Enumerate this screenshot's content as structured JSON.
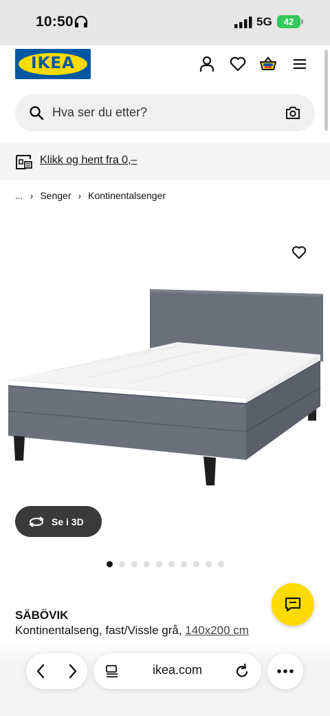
{
  "status_bar": {
    "time": "10:50",
    "network": "5G",
    "battery": "42"
  },
  "header": {
    "logo_text": "IKEA",
    "icons": [
      "profile-icon",
      "heart-icon",
      "basket-icon",
      "menu-icon"
    ]
  },
  "search": {
    "placeholder": "Hva ser du etter?"
  },
  "promo": {
    "link_label": "Klikk og hent fra 0,–"
  },
  "breadcrumb": {
    "ellipsis": "...",
    "items": [
      "Senger",
      "Kontinentalsenger"
    ]
  },
  "product": {
    "view_3d_label": "Se i 3D",
    "image_count": 10,
    "active_image": 1,
    "name": "SÄBÖVIK",
    "description": "Kontinentalseng, fast/Vissle grå,",
    "size": "140x200 cm"
  },
  "browser": {
    "url": "ikea.com"
  },
  "colors": {
    "ikea_blue": "#0058a3",
    "ikea_yellow": "#ffdb00",
    "battery_green": "#34c759",
    "button_dark": "#3a3a3a"
  }
}
